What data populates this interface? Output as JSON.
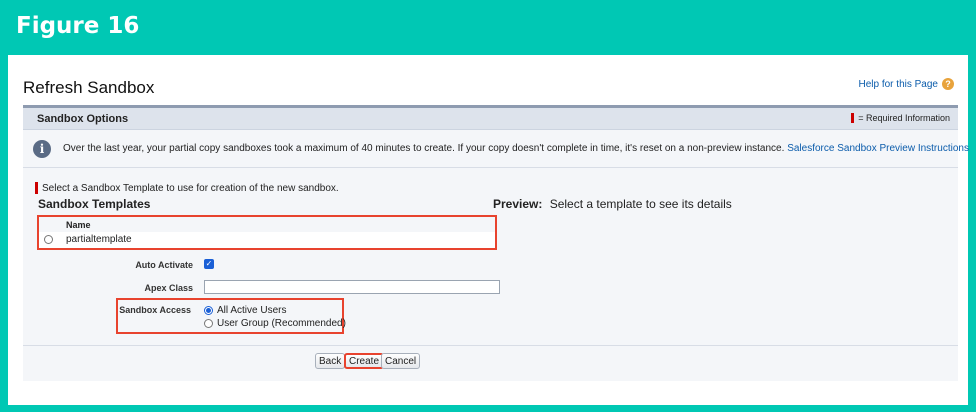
{
  "figure": {
    "title": "Figure 16"
  },
  "page": {
    "title": "Refresh Sandbox",
    "help_link": "Help for this Page",
    "help_icon": "question-icon"
  },
  "section": {
    "title": "Sandbox Options",
    "required_info": "= Required Information"
  },
  "info": {
    "text": "Over the last year, your partial copy sandboxes took a maximum of 40 minutes to create. If your copy doesn't complete in time, it's reset on a non-preview instance.",
    "link": "Salesforce Sandbox Preview Instructions"
  },
  "form": {
    "instruction": "Select a Sandbox Template to use for creation of the new sandbox.",
    "templates_title": "Sandbox Templates",
    "preview_label": "Preview:",
    "preview_text": "Select a template to see its details",
    "table": {
      "column_name": "Name",
      "rows": [
        {
          "name": "partialtemplate",
          "selected": false
        }
      ]
    },
    "auto_activate_label": "Auto Activate",
    "auto_activate_checked": true,
    "apex_class_label": "Apex Class",
    "apex_class_value": "",
    "sandbox_access_label": "Sandbox Access",
    "access_options": [
      {
        "label": "All Active Users",
        "selected": true
      },
      {
        "label": "User Group (Recommended)",
        "selected": false
      }
    ]
  },
  "buttons": {
    "back": "Back",
    "create": "Create",
    "cancel": "Cancel"
  },
  "colors": {
    "frame": "#00c8b4",
    "highlight": "#e8432e",
    "link": "#0b5cab"
  }
}
